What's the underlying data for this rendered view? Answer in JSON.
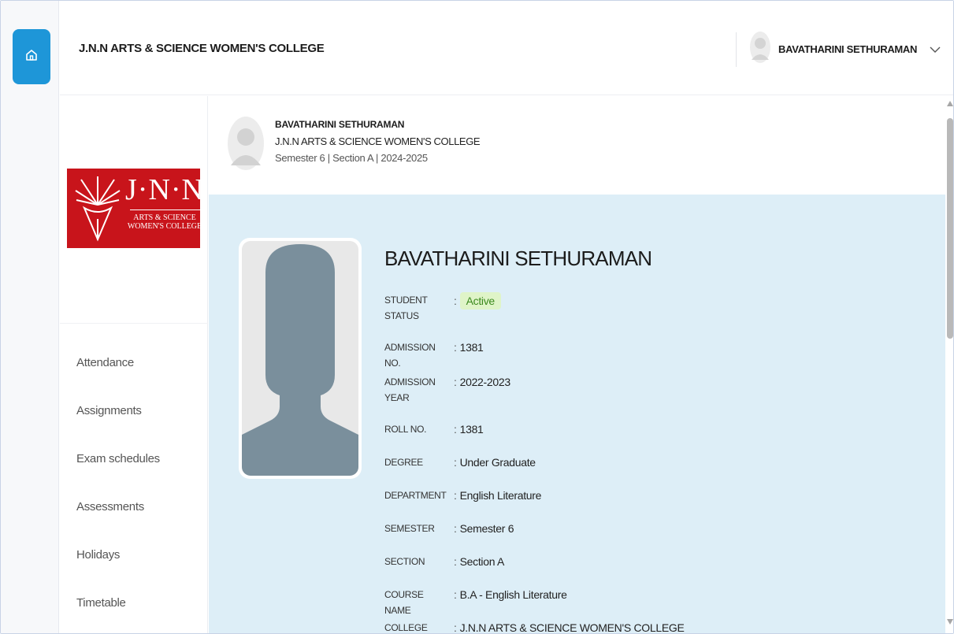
{
  "header": {
    "title": "J.N.N ARTS & SCIENCE WOMEN'S COLLEGE",
    "user_name": "BAVATHARINI SETHURAMAN"
  },
  "rail": {
    "home_icon": "home-icon",
    "accent_color": "#1e96d8"
  },
  "logo": {
    "main": "J·N·N",
    "sub_line1": "ARTS & SCIENCE",
    "sub_line2": "WOMEN'S COLLEGE",
    "color": "#c8141b"
  },
  "sidebar": {
    "items": [
      {
        "label": "Attendance"
      },
      {
        "label": "Assignments"
      },
      {
        "label": "Exam schedules"
      },
      {
        "label": "Assessments"
      },
      {
        "label": "Holidays"
      },
      {
        "label": "Timetable"
      }
    ]
  },
  "profile_strip": {
    "name": "BAVATHARINI SETHURAMAN",
    "college": "J.N.N ARTS & SCIENCE WOMEN'S COLLEGE",
    "meta": "Semester 6 | Section A | 2024-2025"
  },
  "student": {
    "name": "BAVATHARINI SETHURAMAN",
    "fields": [
      {
        "label": "STUDENT STATUS",
        "value": "Active",
        "badge": true
      },
      {
        "label": "ADMISSION NO.",
        "value": "1381"
      },
      {
        "label": "ADMISSION YEAR",
        "value": "2022-2023"
      },
      {
        "label": "ROLL NO.",
        "value": "1381"
      },
      {
        "label": "DEGREE",
        "value": "Under Graduate"
      },
      {
        "label": "DEPARTMENT",
        "value": "English Literature"
      },
      {
        "label": "SEMESTER",
        "value": "Semester 6"
      },
      {
        "label": "SECTION",
        "value": "Section A"
      },
      {
        "label": "COURSE NAME",
        "value": "B.A - English Literature"
      },
      {
        "label": "COLLEGE",
        "value": "J.N.N ARTS & SCIENCE WOMEN'S COLLEGE"
      }
    ],
    "status_color": "#3c8a1e",
    "panel_color": "#ddeef7"
  }
}
